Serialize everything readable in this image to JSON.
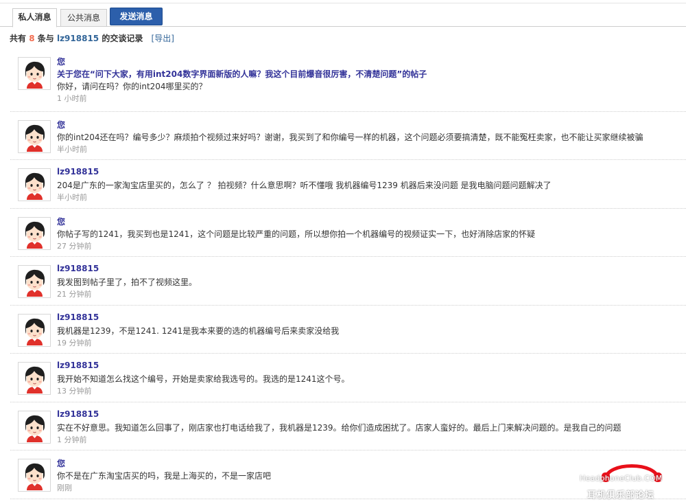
{
  "tabs": {
    "private": "私人消息",
    "public": "公共消息",
    "send": "发送消息"
  },
  "summary": {
    "prefix": "共有",
    "count": "8",
    "middle": "条与",
    "partner": "lz918815",
    "suffix": "的交谈记录",
    "export": "[导出]"
  },
  "messages": [
    {
      "sender": "您",
      "subject": "关于您在“问下大家，有用int204数字界面新版的人嘛？我这个目前爆音很厉害，不清楚问题”的帖子",
      "text": "你好，请问在吗？你的int204哪里买的？",
      "time": "1 小时前"
    },
    {
      "sender": "您",
      "text": "你的int204还在吗？编号多少？麻烦拍个视频过来好吗？谢谢，我买到了和你编号一样的机器，这个问题必须要搞清楚，既不能冤枉卖家，也不能让买家继续被骗",
      "time": "半小时前"
    },
    {
      "sender": "lz918815",
      "text": "204是广东的一家淘宝店里买的，怎么了 ？ 拍视频？什么意思啊？听不懂哦 我机器编号1239 机器后来没问题 是我电脑问题问题解决了",
      "time": "半小时前"
    },
    {
      "sender": "您",
      "text": "你帖子写的1241，我买到也是1241，这个问题是比较严重的问题，所以想你拍一个机器编号的视频证实一下，也好消除店家的怀疑",
      "time": "27 分钟前"
    },
    {
      "sender": "lz918815",
      "text": "我发图到帖子里了，拍不了视频这里。",
      "time": "21 分钟前"
    },
    {
      "sender": "lz918815",
      "text": "我机器是1239，不是1241. 1241是我本来要的选的机器编号后来卖家没给我",
      "time": "19 分钟前"
    },
    {
      "sender": "lz918815",
      "text": "我开始不知道怎么找这个编号，开始是卖家给我选号的。我选的是1241这个号。",
      "time": "13 分钟前"
    },
    {
      "sender": "lz918815",
      "text": "实在不好意思。我知道怎么回事了，刚店家也打电话给我了，我机器是1239。给你们造成困扰了。店家人蛮好的。最后上门来解决问题的。是我自己的问题",
      "time": "1 分钟前"
    },
    {
      "sender": "您",
      "text": "你不是在广东淘宝店买的吗，我是上海买的，不是一家店吧",
      "time": "刚刚"
    }
  ],
  "watermark": {
    "en": "HeadphoneClub.COM",
    "cn": "耳机俱乐部论坛"
  },
  "colors": {
    "accent": "#2c5fab",
    "sender": "#333399",
    "count": "#f26c4f",
    "muted": "#999999"
  }
}
